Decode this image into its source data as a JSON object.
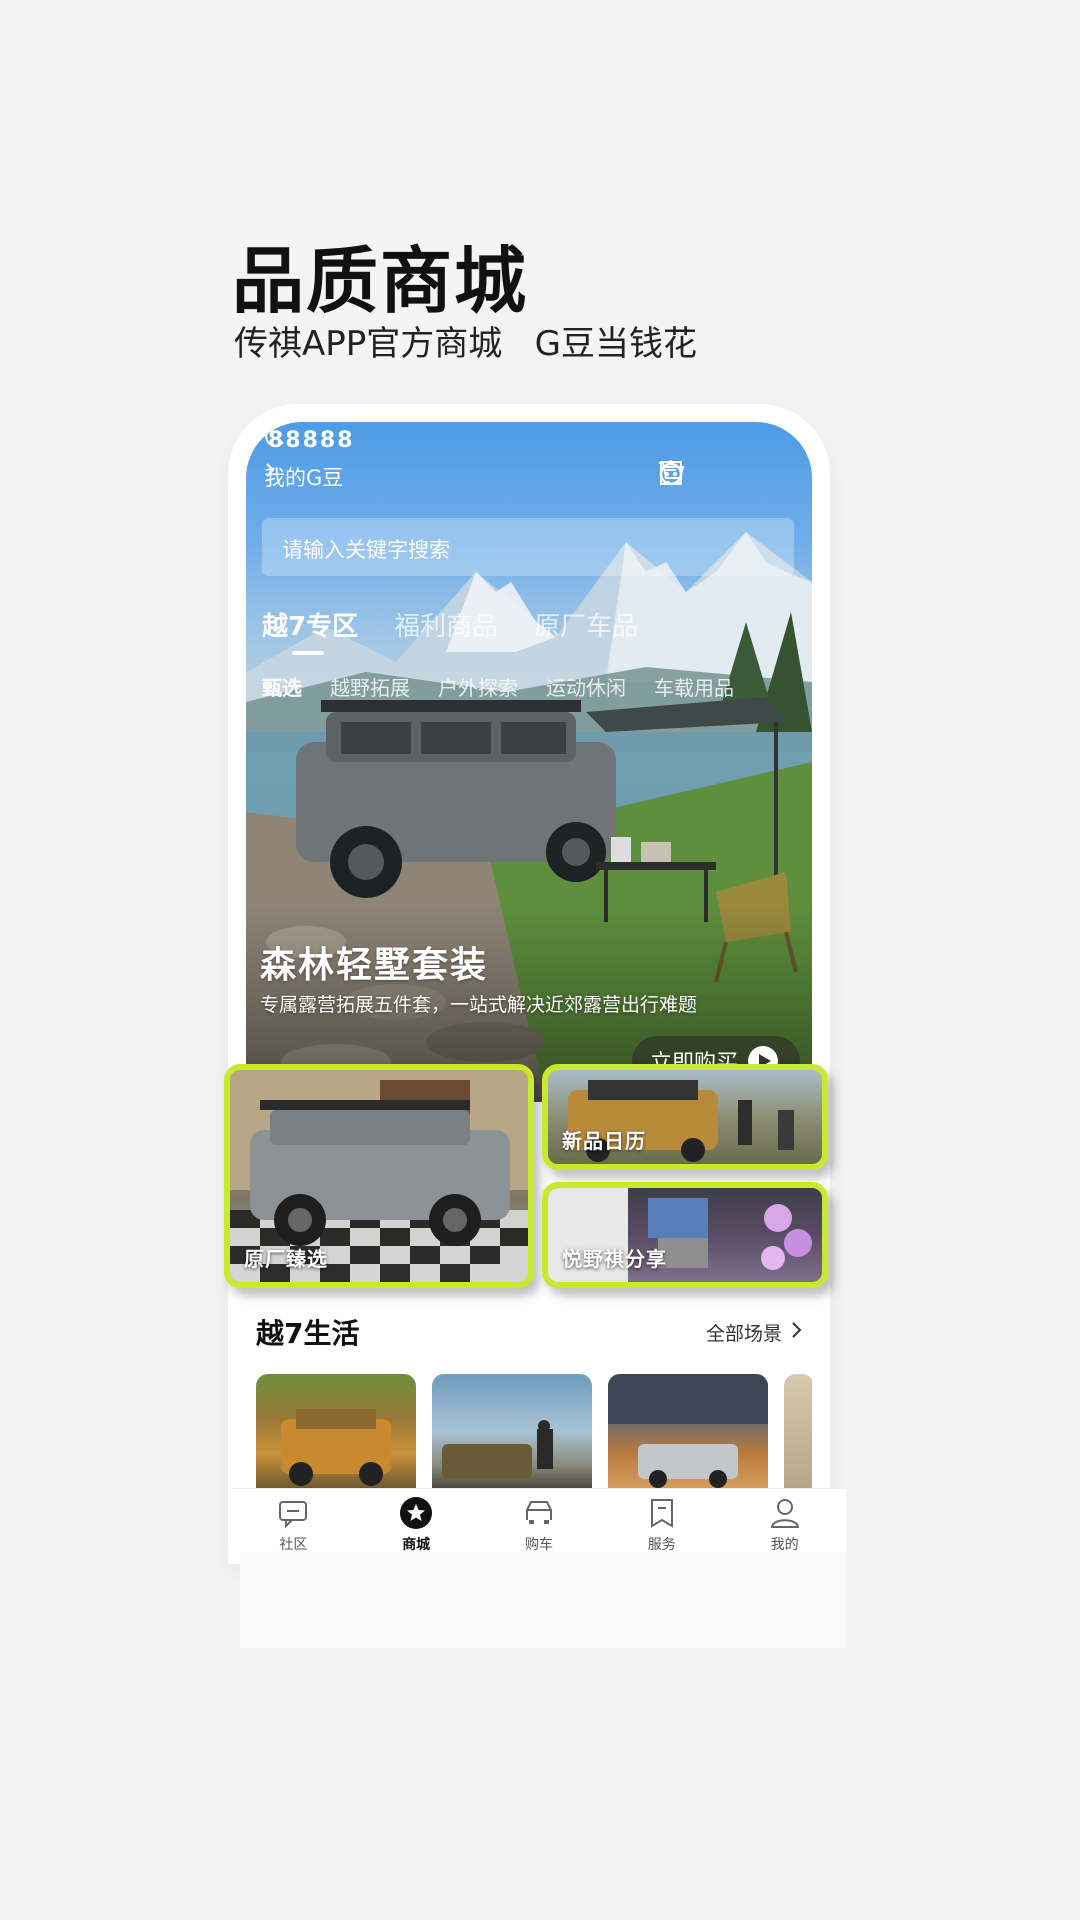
{
  "promo": {
    "title": "品质商城",
    "subtitle": "传祺APP官方商城   G豆当钱花"
  },
  "app": {
    "status_number": "88888",
    "my_gdou": "我的G豆",
    "search_placeholder": "请输入关键字搜索",
    "main_tabs": [
      {
        "label": "越7专区",
        "active": true
      },
      {
        "label": "福利商品",
        "active": false
      },
      {
        "label": "原厂车品",
        "active": false
      }
    ],
    "sub_tabs": [
      {
        "label": "甄选",
        "active": true
      },
      {
        "label": "越野拓展",
        "active": false
      },
      {
        "label": "户外探索",
        "active": false
      },
      {
        "label": "运动休闲",
        "active": false
      },
      {
        "label": "车载用品",
        "active": false
      }
    ],
    "hero": {
      "title": "森林轻墅套装",
      "description": "专属露营拓展五件套，一站式解决近郊露营出行难题",
      "buy_label": "立即购买"
    },
    "cards": {
      "big_label": "原厂臻选",
      "card_a_label": "新品日历",
      "card_b_label": "悦野祺分享"
    },
    "section": {
      "title": "越7生活",
      "link": "全部场景"
    },
    "nav": [
      {
        "label": "社区",
        "icon": "community-icon",
        "active": false
      },
      {
        "label": "商城",
        "icon": "mall-star-icon",
        "active": true
      },
      {
        "label": "购车",
        "icon": "car-icon",
        "active": false
      },
      {
        "label": "服务",
        "icon": "service-icon",
        "active": false
      },
      {
        "label": "我的",
        "icon": "profile-icon",
        "active": false
      }
    ]
  },
  "colors": {
    "accent_lime": "#c7ea2e",
    "sky_blue": "#4d9be6"
  }
}
